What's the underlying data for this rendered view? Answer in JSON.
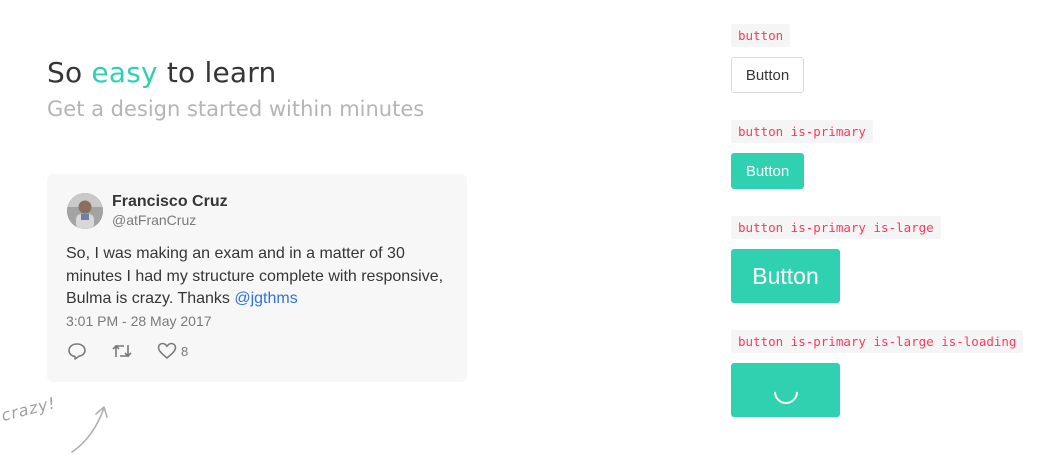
{
  "hero": {
    "title_before": "So ",
    "title_accent": "easy",
    "title_after": " to learn",
    "subtitle": "Get a design started within minutes"
  },
  "tweet": {
    "author_name": "Francisco Cruz",
    "author_handle": "@atFranCruz",
    "text": "So, I was making an exam and in a matter of 30 minutes I had my structure complete with responsive, Bulma is crazy. Thanks ",
    "mention": "@jgthms",
    "timestamp": "3:01 PM - 28 May 2017",
    "like_count": "8"
  },
  "annotation": {
    "text": "crazy!"
  },
  "examples": [
    {
      "code": "button",
      "label": "Button"
    },
    {
      "code": "button is-primary",
      "label": "Button"
    },
    {
      "code": "button is-primary is-large",
      "label": "Button"
    },
    {
      "code": "button is-primary is-large is-loading",
      "label": ""
    }
  ],
  "colors": {
    "primary": "#2fd1b1",
    "code_text": "#ff3860",
    "code_bg": "#f5f5f5",
    "link": "#3273dc"
  }
}
